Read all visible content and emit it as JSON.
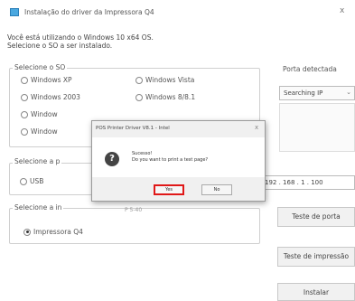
{
  "window": {
    "title": "Instalação do driver da Impressora Q4",
    "close_glyph": "x"
  },
  "intro": {
    "line1": "Você está utilizando o Windows 10 x64 OS.",
    "line2": "Selecione o SO a ser instalado."
  },
  "os_group": {
    "label": "Selecione o SO",
    "options": [
      {
        "label": "Windows XP",
        "checked": false
      },
      {
        "label": "Windows Vista",
        "checked": false
      },
      {
        "label": "Windows 2003",
        "checked": false
      },
      {
        "label": "Windows 8/8.1",
        "checked": false
      },
      {
        "label": "Window",
        "checked": false
      },
      {
        "label": "Window",
        "checked": false
      }
    ]
  },
  "port_group": {
    "label": "Selecione a p",
    "usb_label": "USB"
  },
  "printer_group": {
    "label": "Selecione a in",
    "option_label": "Impressora Q4",
    "hidden_ip_text": "P 5-40"
  },
  "right_panel": {
    "port_detected_label": "Porta detectada",
    "select_value": "Searching IP",
    "ip_value": "192 . 168 . 1 . 100",
    "buttons": {
      "test_port": "Teste de porta",
      "test_print": "Teste de impressão",
      "install": "Instalar"
    }
  },
  "dialog": {
    "title": "POS Printer Driver V8.1 - Intel",
    "close_glyph": "x",
    "message_line1": "Sucesso!",
    "message_line2": "Do you want to print a test page?",
    "yes_label": "Yes",
    "no_label": "No",
    "highlight_color": "#e01818"
  },
  "icons": {
    "app": "printer-app-icon",
    "question": "question-icon"
  }
}
